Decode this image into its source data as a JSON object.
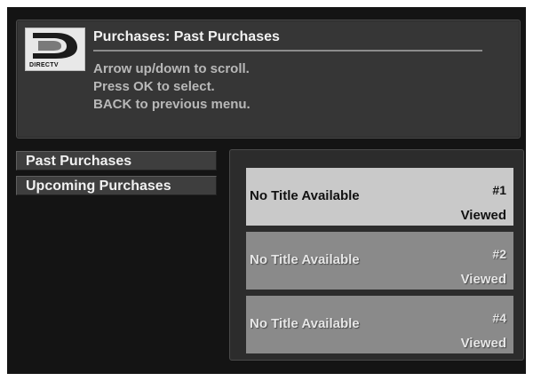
{
  "header": {
    "logo_text": "DIRECTV",
    "title": "Purchases: Past Purchases",
    "instructions": [
      "Arrow up/down to scroll.",
      "Press OK to select.",
      "BACK to previous menu."
    ]
  },
  "menu": {
    "items": [
      {
        "label": "Past Purchases"
      },
      {
        "label": "Upcoming Purchases"
      }
    ]
  },
  "purchases": {
    "items": [
      {
        "title": "No Title Available",
        "number": "#1",
        "status": "Viewed",
        "selected": true
      },
      {
        "title": "No Title Available",
        "number": "#2",
        "status": "Viewed",
        "selected": false
      },
      {
        "title": "No Title Available",
        "number": "#4",
        "status": "Viewed",
        "selected": false
      }
    ]
  },
  "colors": {
    "background": "#141414",
    "panel": "#363636",
    "selected_item": "#c9c9c9",
    "item": "#8a8a8a"
  },
  "icons": {
    "logo": "directv-logo-icon"
  }
}
